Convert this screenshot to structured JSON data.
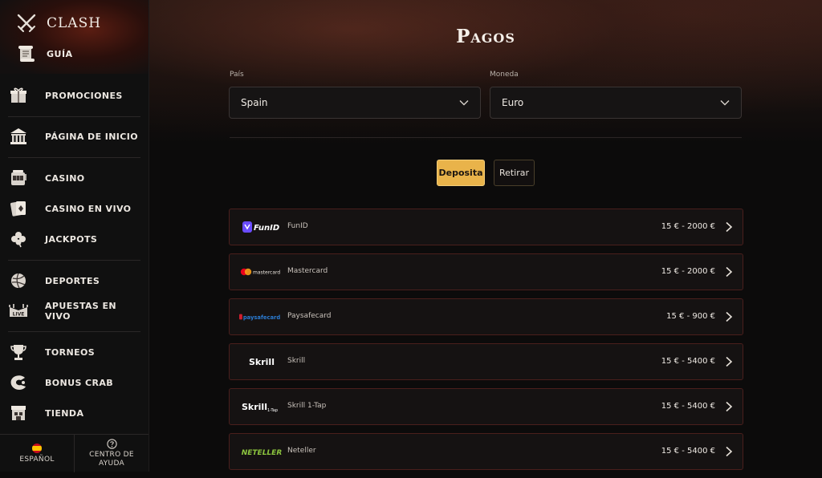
{
  "sidebar": {
    "brand": "CLASH",
    "guide": "GUÍA",
    "groups": [
      [
        {
          "label": "PROMOCIONES",
          "icon": "gift-icon"
        }
      ],
      [
        {
          "label": "PÁGINA DE INICIO",
          "icon": "temple-icon"
        }
      ],
      [
        {
          "label": "CASINO",
          "icon": "slot-machine-icon"
        },
        {
          "label": "CASINO EN VIVO",
          "icon": "playing-cards-icon"
        },
        {
          "label": "JACKPOTS",
          "icon": "clover-icon"
        }
      ],
      [
        {
          "label": "DEPORTES",
          "icon": "ball-icon"
        },
        {
          "label": "APUESTAS EN VIVO",
          "icon": "live-stadium-icon"
        }
      ],
      [
        {
          "label": "TORNEOS",
          "icon": "trophy-icon"
        },
        {
          "label": "BONUS CRAB",
          "icon": "crab-icon"
        },
        {
          "label": "TIENDA",
          "icon": "shop-icon"
        }
      ]
    ],
    "footer": {
      "language": "ESPAÑOL",
      "help_line1": "CENTRO DE",
      "help_line2": "AYUDA"
    }
  },
  "main": {
    "title": "Pagos",
    "country_label": "País",
    "country_value": "Spain",
    "currency_label": "Moneda",
    "currency_value": "Euro",
    "tab_deposit": "Deposita",
    "tab_withdraw": "Retirar",
    "methods": [
      {
        "name": "FunID",
        "range": "15 € - 2000 €",
        "logo_text": "FunID"
      },
      {
        "name": "Mastercard",
        "range": "15 € - 2000 €",
        "logo_text": "mastercard"
      },
      {
        "name": "Paysafecard",
        "range": "15 € - 900 €",
        "logo_text": "paysafecard"
      },
      {
        "name": "Skrill",
        "range": "15 € - 5400 €",
        "logo_text": "Skrill"
      },
      {
        "name": "Skrill 1-Tap",
        "range": "15 € - 5400 €",
        "logo_text": "Skrill",
        "logo_sub": "1-Tap"
      },
      {
        "name": "Neteller",
        "range": "15 € - 5400 €",
        "logo_text": "NETELLER"
      }
    ]
  },
  "colors": {
    "accent": "#e9b34a",
    "card_border": "#4a1f1c",
    "neteller": "#8dc63f",
    "mastercard_red": "#eb001b",
    "mastercard_orange": "#f79e1b",
    "paysafe_blue": "#2b7bd2",
    "funid_purple": "#6a4cff"
  }
}
